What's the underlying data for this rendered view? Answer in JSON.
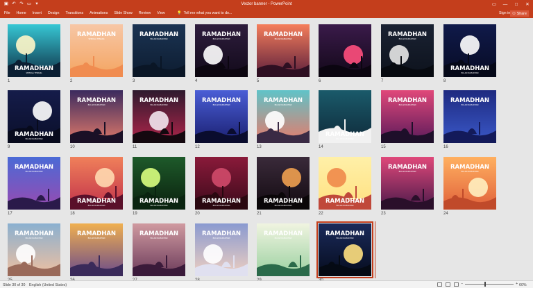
{
  "window": {
    "title": "Vector banner - PowerPoint",
    "sign_in": "Sign in",
    "share": "Share"
  },
  "ribbon": {
    "tabs": [
      "File",
      "Home",
      "Insert",
      "Design",
      "Transitions",
      "Animations",
      "Slide Show",
      "Review",
      "View"
    ],
    "tell_me": "Tell me what you want to do..."
  },
  "slides": [
    {
      "num": "1",
      "bg": [
        "#37c7d4",
        "#0e2f45"
      ],
      "sil": "#0b1f33",
      "sun": "#fff6c8",
      "title": "RAMADHAN",
      "sub": "SEMOGA TENANG",
      "tpos": "bottom"
    },
    {
      "num": "2",
      "bg": [
        "#f7c7a6",
        "#f4a460"
      ],
      "sil": "#f08c50",
      "sun": "",
      "title": "RAMADHAN",
      "sub": "SEMOGA TENANG",
      "tpos": "top"
    },
    {
      "num": "3",
      "bg": [
        "#1b3453",
        "#0d1c30"
      ],
      "sil": "#0a1626",
      "sun": "",
      "title": "RAMADHAN",
      "sub": "BULAN RAMADHAN",
      "tpos": "top"
    },
    {
      "num": "4",
      "bg": [
        "#2e1d3d",
        "#120a1a"
      ],
      "sil": "#0c0610",
      "sun": "#ffffff",
      "title": "RAMADHAN",
      "sub": "BULAN RAMADHAN",
      "tpos": "top"
    },
    {
      "num": "5",
      "bg": [
        "#f57e5b",
        "#5a1e3c"
      ],
      "sil": "#2e0f22",
      "sun": "",
      "title": "RAMADHAN",
      "sub": "BULAN RAMADHAN",
      "tpos": "top"
    },
    {
      "num": "6",
      "bg": [
        "#3a1a4a",
        "#120818"
      ],
      "sil": "#0b0510",
      "sun": "#ff4f7d",
      "title": "",
      "sub": "",
      "tpos": "none"
    },
    {
      "num": "7",
      "bg": [
        "#1a2233",
        "#0d121c"
      ],
      "sil": "#070a10",
      "sun": "#e8e8e8",
      "title": "RAMADHAN",
      "sub": "BULAN RAMADHAN",
      "tpos": "top"
    },
    {
      "num": "8",
      "bg": [
        "#101a4a",
        "#070b24"
      ],
      "sil": "#050818",
      "sun": "#ffffff",
      "title": "RAMADHAN",
      "sub": "BULAN RAMADHAN",
      "tpos": "bottom"
    },
    {
      "num": "9",
      "bg": [
        "#151c4a",
        "#0a0f2a"
      ],
      "sil": "#070a1c",
      "sun": "#ffffff",
      "title": "RAMADHAN",
      "sub": "BULAN RAMADHAN",
      "tpos": "bottom"
    },
    {
      "num": "10",
      "bg": [
        "#3b2a5e",
        "#e07a6a"
      ],
      "sil": "#1a1026",
      "sun": "",
      "title": "RAMADHAN",
      "sub": "BULAN RAMADHAN",
      "tpos": "top"
    },
    {
      "num": "11",
      "bg": [
        "#2e1a2e",
        "#b0254a"
      ],
      "sil": "#14080f",
      "sun": "#f2e6ee",
      "title": "RAMADHAN",
      "sub": "BULAN RAMADHAN",
      "tpos": "top"
    },
    {
      "num": "12",
      "bg": [
        "#4a5ed6",
        "#1a1f70"
      ],
      "sil": "#0a0c2e",
      "sun": "",
      "title": "RAMADHAN",
      "sub": "BULAN RAMADHAN",
      "tpos": "top"
    },
    {
      "num": "13",
      "bg": [
        "#5fc3c8",
        "#e87a6a"
      ],
      "sil": "#3a2a44",
      "sun": "#ffffff",
      "title": "RAMADHAN",
      "sub": "BULAN RAMADHAN",
      "tpos": "top"
    },
    {
      "num": "14",
      "bg": [
        "#1a5a6a",
        "#0f2a3a"
      ],
      "sil": "#f2f2f2",
      "sun": "",
      "title": "RAMADHAN",
      "sub": "BULAN RAMADHAN",
      "tpos": "bottom"
    },
    {
      "num": "15",
      "bg": [
        "#e0487a",
        "#5a1a5a"
      ],
      "sil": "#1e0f2a",
      "sun": "",
      "title": "RAMADHAN",
      "sub": "BULAN RAMADHAN",
      "tpos": "top"
    },
    {
      "num": "16",
      "bg": [
        "#1e2a80",
        "#3a58c8"
      ],
      "sil": "#131a5a",
      "sun": "",
      "title": "RAMADHAN",
      "sub": "BULAN RAMADHAN",
      "tpos": "top"
    },
    {
      "num": "17",
      "bg": [
        "#4a6ad6",
        "#9a4ab0"
      ],
      "sil": "#2a1a4a",
      "sun": "",
      "title": "RAMADHAN",
      "sub": "BULAN RAMADHAN",
      "tpos": "top"
    },
    {
      "num": "18",
      "bg": [
        "#f0805a",
        "#c0304a"
      ],
      "sil": "#5a102a",
      "sun": "#ffd9b0",
      "title": "RAMADHAN",
      "sub": "BULAN RAMADHAN",
      "tpos": "bottom"
    },
    {
      "num": "19",
      "bg": [
        "#1e5a2a",
        "#0a200e"
      ],
      "sil": "#0a2410",
      "sun": "#d9ff80",
      "title": "RAMADHAN",
      "sub": "BULAN RAMADHAN",
      "tpos": "bottom"
    },
    {
      "num": "20",
      "bg": [
        "#8a1a3a",
        "#3a0a1a"
      ],
      "sil": "#2a0810",
      "sun": "#d04a6a",
      "title": "RAMADHAN",
      "sub": "BULAN RAMADHAN",
      "tpos": "bottom"
    },
    {
      "num": "21",
      "bg": [
        "#3a2a3a",
        "#120a10"
      ],
      "sil": "#0a0608",
      "sun": "#f0a050",
      "title": "RAMADHAN",
      "sub": "BULAN RAMADHAN",
      "tpos": "bottom"
    },
    {
      "num": "22",
      "bg": [
        "#fff0a8",
        "#ffe080"
      ],
      "sil": "#c0483a",
      "sun": "#f08a4a",
      "title": "RAMADHAN",
      "sub": "BULAN RAMADHAN",
      "tpos": "bottom"
    },
    {
      "num": "23",
      "bg": [
        "#e0487a",
        "#4a1a4a"
      ],
      "sil": "#2a0f2a",
      "sun": "",
      "title": "RAMADHAN",
      "sub": "BULAN RAMADHAN",
      "tpos": "top"
    },
    {
      "num": "24",
      "bg": [
        "#ffb060",
        "#e0603a"
      ],
      "sil": "#c04a2a",
      "sun": "#fff0c0",
      "title": "RAMADHAN",
      "sub": "BULAN RAMADHAN",
      "tpos": "top"
    },
    {
      "num": "25",
      "bg": [
        "#8ab0d0",
        "#f0c0a0"
      ],
      "sil": "#9a6a5a",
      "sun": "#ffffff",
      "title": "RAMADHAN",
      "sub": "BULAN RAMADHAN",
      "tpos": "top"
    },
    {
      "num": "26",
      "bg": [
        "#f0b050",
        "#6a4a8a"
      ],
      "sil": "#3a2a5a",
      "sun": "",
      "title": "RAMADHAN",
      "sub": "BULAN RAMADHAN",
      "tpos": "top"
    },
    {
      "num": "27",
      "bg": [
        "#d09aa0",
        "#6a3a5a"
      ],
      "sil": "#3a1a3a",
      "sun": "",
      "title": "RAMADHAN",
      "sub": "BULAN RAMADHAN",
      "tpos": "top"
    },
    {
      "num": "28",
      "bg": [
        "#8a9ad0",
        "#f0d0c0"
      ],
      "sil": "#e0e0f0",
      "sun": "#ffffff",
      "title": "RAMADHAN",
      "sub": "BULAN RAMADHAN",
      "tpos": "top"
    },
    {
      "num": "29",
      "bg": [
        "#f0f4e0",
        "#9ad0a0"
      ],
      "sil": "#2a6a4a",
      "sun": "",
      "title": "RAMADHAN",
      "sub": "BULAN RAMADHAN",
      "tpos": "top"
    },
    {
      "num": "30",
      "bg": [
        "#1a2a5a",
        "#060c1e"
      ],
      "sil": "#050a14",
      "sun": "#ffe080",
      "title": "RAMADHAN",
      "sub": "BULAN RAMADHAN",
      "tpos": "top"
    }
  ],
  "status": {
    "slide_info": "Slide 30 of 30",
    "language": "English (United States)",
    "zoom": "60%",
    "zoom_level": 0.6
  }
}
